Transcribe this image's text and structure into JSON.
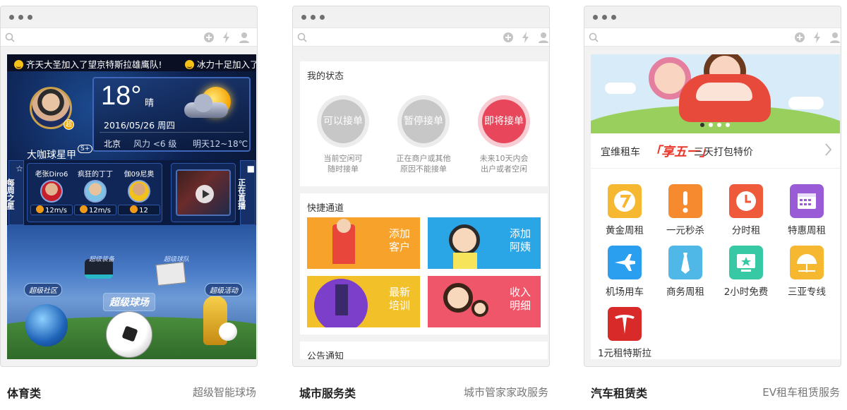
{
  "panels": [
    {
      "caption": {
        "title": "体育类",
        "subtitle": "超级智能球场"
      },
      "sports": {
        "ticker": [
          "齐天大圣加入了望京特斯拉雄鹰队!",
          "冰力十足加入了"
        ],
        "nickname": "大咖球星甲",
        "level": "S+",
        "avatar_badge": "超",
        "weather": {
          "temp": "18°",
          "desc": "晴",
          "date": "2016/05/26  周四",
          "city": "北京",
          "wind": "风力 <6 级",
          "tomorrow": "明天12~18℃"
        },
        "weekly_star_tab": "每周之星",
        "live_tab": "正在直播",
        "players": [
          {
            "name": "老张Diro6",
            "stat": "12m/s"
          },
          {
            "name": "疯狂的丁丁",
            "stat": "12m/s"
          },
          {
            "name": "伽09尼奥",
            "stat": "12"
          }
        ],
        "zones": {
          "community": "超级社区",
          "equipment": "超级装备",
          "team": "超级球队",
          "stadium": "超级球场",
          "activity": "超级活动"
        }
      }
    },
    {
      "caption": {
        "title": "城市服务类",
        "subtitle": "城市管家家政服务"
      },
      "city": {
        "status_title": "我的状态",
        "statuses": [
          {
            "label": "可以接单",
            "desc1": "当前空闲可",
            "desc2": "随时接单",
            "color": "#c7c7c7"
          },
          {
            "label": "暂停接单",
            "desc1": "正在商户或其他",
            "desc2": "原因不能接单",
            "color": "#c7c7c7"
          },
          {
            "label": "即将接单",
            "desc1": "未来10天内会",
            "desc2": "出户或者空闲",
            "color": "#e8465a"
          }
        ],
        "shortcut_title": "快捷通道",
        "shortcuts": [
          {
            "l1": "添加",
            "l2": "客户",
            "color": "#f7a22b"
          },
          {
            "l1": "添加",
            "l2": "阿姨",
            "color": "#2aa5e6"
          },
          {
            "l1": "最新",
            "l2": "培训",
            "color": "#f2c12a"
          },
          {
            "l1": "收入",
            "l2": "明细",
            "color": "#f0566a"
          }
        ],
        "notice_title": "公告通知"
      }
    },
    {
      "caption": {
        "title": "汽车租赁类",
        "subtitle": "EV租车租赁服务"
      },
      "car": {
        "promo": {
          "prefix": "宜维租车",
          "highlight": "「享五一」",
          "suffix": "三天打包特价"
        },
        "services": [
          {
            "label": "黄金周租",
            "color": "#f6b731",
            "icon": "seven-icon"
          },
          {
            "label": "一元秒杀",
            "color": "#f58b2e",
            "icon": "exclamation-icon"
          },
          {
            "label": "分时租",
            "color": "#ee5a3a",
            "icon": "clock-icon"
          },
          {
            "label": "特惠周租",
            "color": "#9a5bd6",
            "icon": "calendar-icon"
          },
          {
            "label": "机场用车",
            "color": "#2a9ff0",
            "icon": "airplane-icon"
          },
          {
            "label": "商务周租",
            "color": "#4fb8e6",
            "icon": "tie-icon"
          },
          {
            "label": "2小时免费",
            "color": "#36c9a4",
            "icon": "star-screen-icon"
          },
          {
            "label": "三亚专线",
            "color": "#f6b731",
            "icon": "umbrella-icon"
          },
          {
            "label": "1元租特斯拉",
            "color": "#d92a2a",
            "icon": "tesla-icon"
          }
        ]
      }
    }
  ]
}
